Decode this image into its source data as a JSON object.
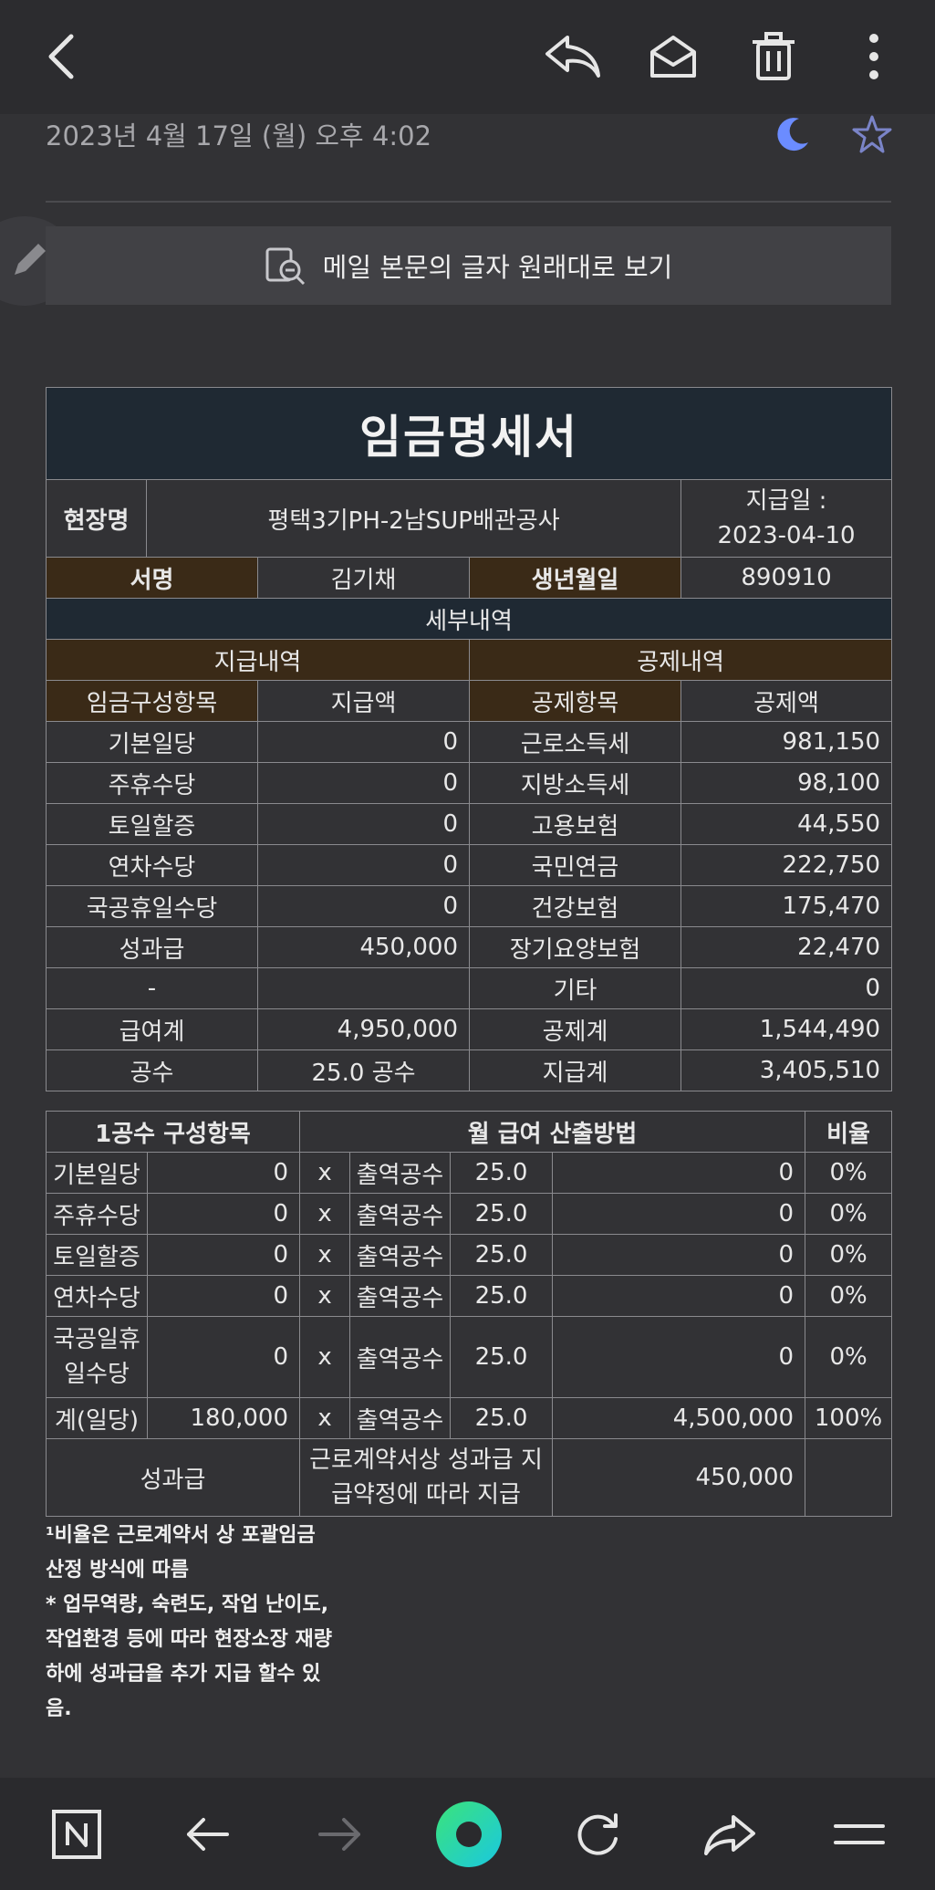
{
  "header": {
    "date": "2023년 4월 17일 (월) 오후 4:02",
    "original_view_label": "메일 본문의 글자 원래대로 보기"
  },
  "payslip": {
    "title": "임금명세서",
    "site_label": "현장명",
    "site_value": "평택3기PH-2남SUP배관공사",
    "pay_date_label": "지급일 :",
    "pay_date_value": "2023-04-10",
    "name_label": "서명",
    "name_value": "김기채",
    "birth_label": "생년월일",
    "birth_value": "890910",
    "details_label": "세부내역",
    "payment_section": "지급내역",
    "deduction_section": "공제내역",
    "col_item": "임금구성항목",
    "col_amount": "지급액",
    "col_ded_item": "공제항목",
    "col_ded_amount": "공제액",
    "rows": [
      {
        "item": "기본일당",
        "amount": "0",
        "ded_item": "근로소득세",
        "ded_amount": "981,150"
      },
      {
        "item": "주휴수당",
        "amount": "0",
        "ded_item": "지방소득세",
        "ded_amount": "98,100"
      },
      {
        "item": "토일할증",
        "amount": "0",
        "ded_item": "고용보험",
        "ded_amount": "44,550"
      },
      {
        "item": "연차수당",
        "amount": "0",
        "ded_item": "국민연금",
        "ded_amount": "222,750"
      },
      {
        "item": "국공휴일수당",
        "amount": "0",
        "ded_item": "건강보험",
        "ded_amount": "175,470"
      },
      {
        "item": "성과급",
        "amount": "450,000",
        "ded_item": "장기요양보험",
        "ded_amount": "22,470"
      },
      {
        "item": "-",
        "amount": "",
        "ded_item": "기타",
        "ded_amount": "0"
      },
      {
        "item": "급여계",
        "amount": "4,950,000",
        "ded_item": "공제계",
        "ded_amount": "1,544,490"
      },
      {
        "item": "공수",
        "amount": "25.0 공수",
        "ded_item": "지급계",
        "ded_amount": "3,405,510"
      }
    ]
  },
  "calc": {
    "col1": "1공수 구성항목",
    "col2": "월 급여 산출방법",
    "col3": "비율",
    "times": "x",
    "days_label": "출역공수",
    "rows": [
      {
        "item": "기본일당",
        "unit": "0",
        "days": "25.0",
        "total": "0",
        "ratio": "0%"
      },
      {
        "item": "주휴수당",
        "unit": "0",
        "days": "25.0",
        "total": "0",
        "ratio": "0%"
      },
      {
        "item": "토일할증",
        "unit": "0",
        "days": "25.0",
        "total": "0",
        "ratio": "0%"
      },
      {
        "item": "연차수당",
        "unit": "0",
        "days": "25.0",
        "total": "0",
        "ratio": "0%"
      }
    ],
    "holiday_row": {
      "item_line1": "국공일휴",
      "item_line2": "일수당",
      "unit": "0",
      "days": "25.0",
      "total": "0",
      "ratio": "0%"
    },
    "sum_row": {
      "item": "계(일당)",
      "unit": "180,000",
      "days": "25.0",
      "total": "4,500,000",
      "ratio": "100%"
    },
    "bonus_row": {
      "item": "성과급",
      "desc_line1": "근로계약서상 성과급 지",
      "desc_line2": "급약정에 따라 지급",
      "total": "450,000"
    }
  },
  "footnote": {
    "line1": "¹비율은 근로계약서 상 포괄임금",
    "line2": "산정 방식에 따름",
    "line3": "* 업무역량, 숙련도, 작업 난이도,",
    "line4": "작업환경 등에 따라 현장소장 재량",
    "line5": "하에 성과급을 추가 지급 할수 있",
    "line6": "음."
  },
  "icons": {
    "back": "back-icon",
    "reply": "reply-icon",
    "mail": "mail-open-icon",
    "trash": "trash-icon",
    "more": "more-vertical-icon",
    "moon": "moon-icon",
    "star": "star-icon",
    "pencil": "pencil-icon",
    "zoom": "zoom-out-icon",
    "n": "naver-n-icon",
    "arrow_back": "arrow-left-icon",
    "arrow_forward": "arrow-right-icon",
    "home": "green-ring-icon",
    "refresh": "refresh-icon",
    "share": "share-icon",
    "menu": "menu-icon"
  },
  "colors": {
    "background": "#323235",
    "navy": "#1f2933",
    "brown": "#3a2a17",
    "moon": "#6b8cff",
    "ring": "#2ce0a0"
  }
}
